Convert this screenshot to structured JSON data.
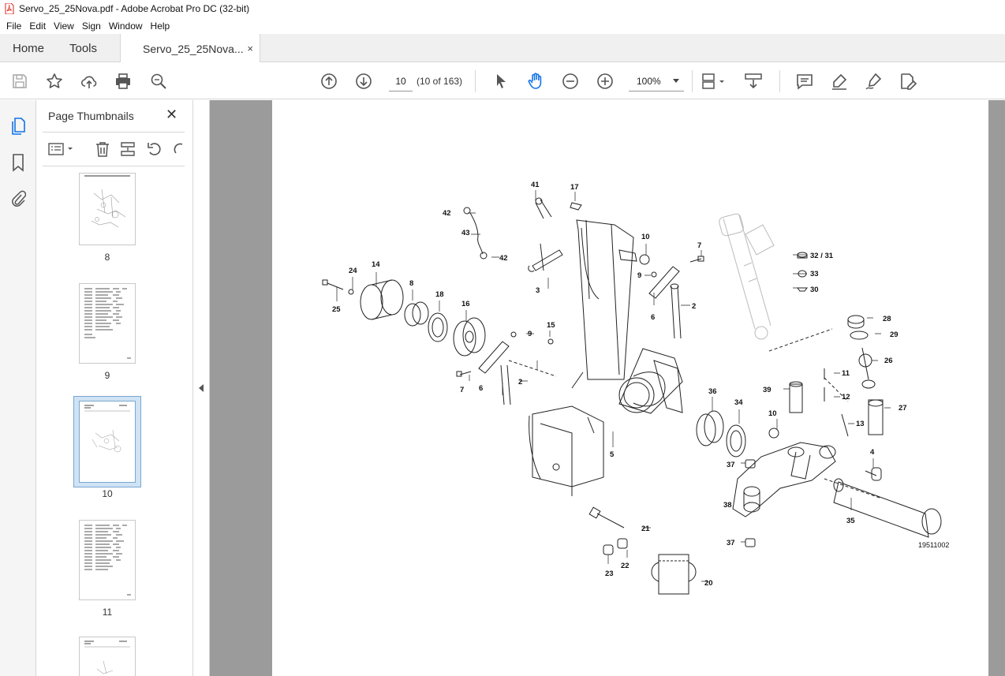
{
  "window": {
    "title": "Servo_25_25Nova.pdf - Adobe Acrobat Pro DC (32-bit)"
  },
  "menu": [
    "File",
    "Edit",
    "View",
    "Sign",
    "Window",
    "Help"
  ],
  "tabs": {
    "home": "Home",
    "tools": "Tools",
    "document": "Servo_25_25Nova...",
    "close": "×"
  },
  "toolbar": {
    "page_number": "10",
    "page_count": "(10 of 163)",
    "zoom": "100%",
    "icons": [
      "save-icon",
      "star-icon",
      "upload-icon",
      "print-icon",
      "zoom-search-icon",
      "page-up-icon",
      "page-down-icon",
      "select-cursor-icon",
      "hand-icon",
      "zoom-out-icon",
      "zoom-in-icon",
      "page-display-icon",
      "scroll-mode-icon",
      "comment-icon",
      "highlight-icon",
      "pen-icon",
      "edit-sign-icon"
    ]
  },
  "thumbnail_panel": {
    "title": "Page Thumbnails",
    "close": "✕",
    "pages": [
      {
        "label": "8",
        "kind": "drawing"
      },
      {
        "label": "9",
        "kind": "table"
      },
      {
        "label": "10",
        "kind": "drawing",
        "selected": true
      },
      {
        "label": "11",
        "kind": "table"
      },
      {
        "label": "",
        "kind": "drawing"
      }
    ]
  },
  "diagram": {
    "figure_number": "19511002",
    "callouts": [
      "41",
      "17",
      "42",
      "43",
      "42",
      "10",
      "7",
      "3",
      "9",
      "6",
      "2",
      "14",
      "24",
      "8",
      "18",
      "16",
      "25",
      "9",
      "15",
      "7",
      "6",
      "2",
      "5",
      "36",
      "34",
      "39",
      "10",
      "11",
      "12",
      "13",
      "32 / 31",
      "33",
      "30",
      "28",
      "29",
      "26",
      "27",
      "4",
      "37",
      "38",
      "35",
      "37",
      "21",
      "23",
      "22",
      "20"
    ]
  },
  "colors": {
    "accent": "#1473e6",
    "toolbar_icon": "#555555",
    "doc_background": "#9b9b9b"
  }
}
